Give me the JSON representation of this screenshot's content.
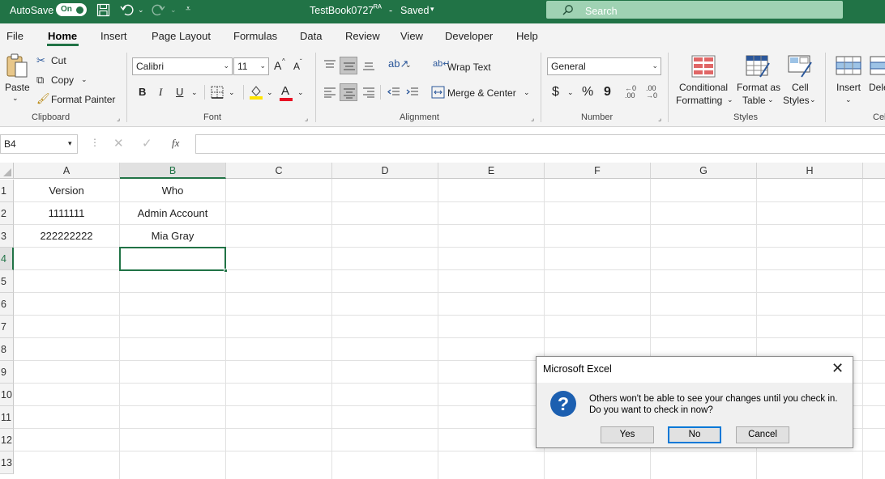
{
  "titlebar": {
    "autosave_label": "AutoSave",
    "autosave_state": "On",
    "document_title": "TestBook0727",
    "save_status": "Saved",
    "search_placeholder": "Search"
  },
  "menu": {
    "tabs": [
      "File",
      "Home",
      "Insert",
      "Page Layout",
      "Formulas",
      "Data",
      "Review",
      "View",
      "Developer",
      "Help"
    ],
    "active": "Home"
  },
  "ribbon": {
    "clipboard": {
      "paste": "Paste",
      "cut": "Cut",
      "copy": "Copy",
      "format_painter": "Format Painter",
      "group": "Clipboard"
    },
    "font": {
      "name": "Calibri",
      "size": "11",
      "group": "Font",
      "bold": "B",
      "italic": "I",
      "underline": "U",
      "font_color_letter": "A",
      "grow": "A",
      "shrink": "A"
    },
    "alignment": {
      "wrap_text": "Wrap Text",
      "merge_center": "Merge & Center",
      "group": "Alignment"
    },
    "number": {
      "format": "General",
      "group": "Number",
      "currency": "$",
      "percent": "%",
      "comma": "9"
    },
    "styles": {
      "conditional_line1": "Conditional",
      "conditional_line2": "Formatting",
      "format_table_line1": "Format as",
      "format_table_line2": "Table",
      "cell_styles_line1": "Cell",
      "cell_styles_line2": "Styles",
      "group": "Styles"
    },
    "cells": {
      "insert": "Insert",
      "delete": "Dele",
      "group": "Cel"
    }
  },
  "formula_bar": {
    "name_box": "B4",
    "fx": "fx",
    "content": ""
  },
  "sheet": {
    "columns": [
      "A",
      "B",
      "C",
      "D",
      "E",
      "F",
      "G",
      "H"
    ],
    "rows": [
      "1",
      "2",
      "3",
      "4",
      "5",
      "6",
      "7",
      "8",
      "9",
      "10",
      "11",
      "12",
      "13"
    ],
    "cells": {
      "A1": "Version",
      "B1": "Who",
      "A2": "1111111",
      "B2": "Admin Account",
      "A3": "222222222",
      "B3": "Mia Gray"
    },
    "selected_cell": "B4"
  },
  "dialog": {
    "title": "Microsoft Excel",
    "message_line1": "Others won't be able to see your changes until you check in.",
    "message_line2": "Do you want to check in now?",
    "yes": "Yes",
    "no": "No",
    "cancel": "Cancel"
  },
  "colors": {
    "brand": "#217346",
    "dialog_question": "#1c5fb0",
    "default_button_border": "#0078d7",
    "font_color": "#e81123",
    "highlight": "#ffe400"
  }
}
